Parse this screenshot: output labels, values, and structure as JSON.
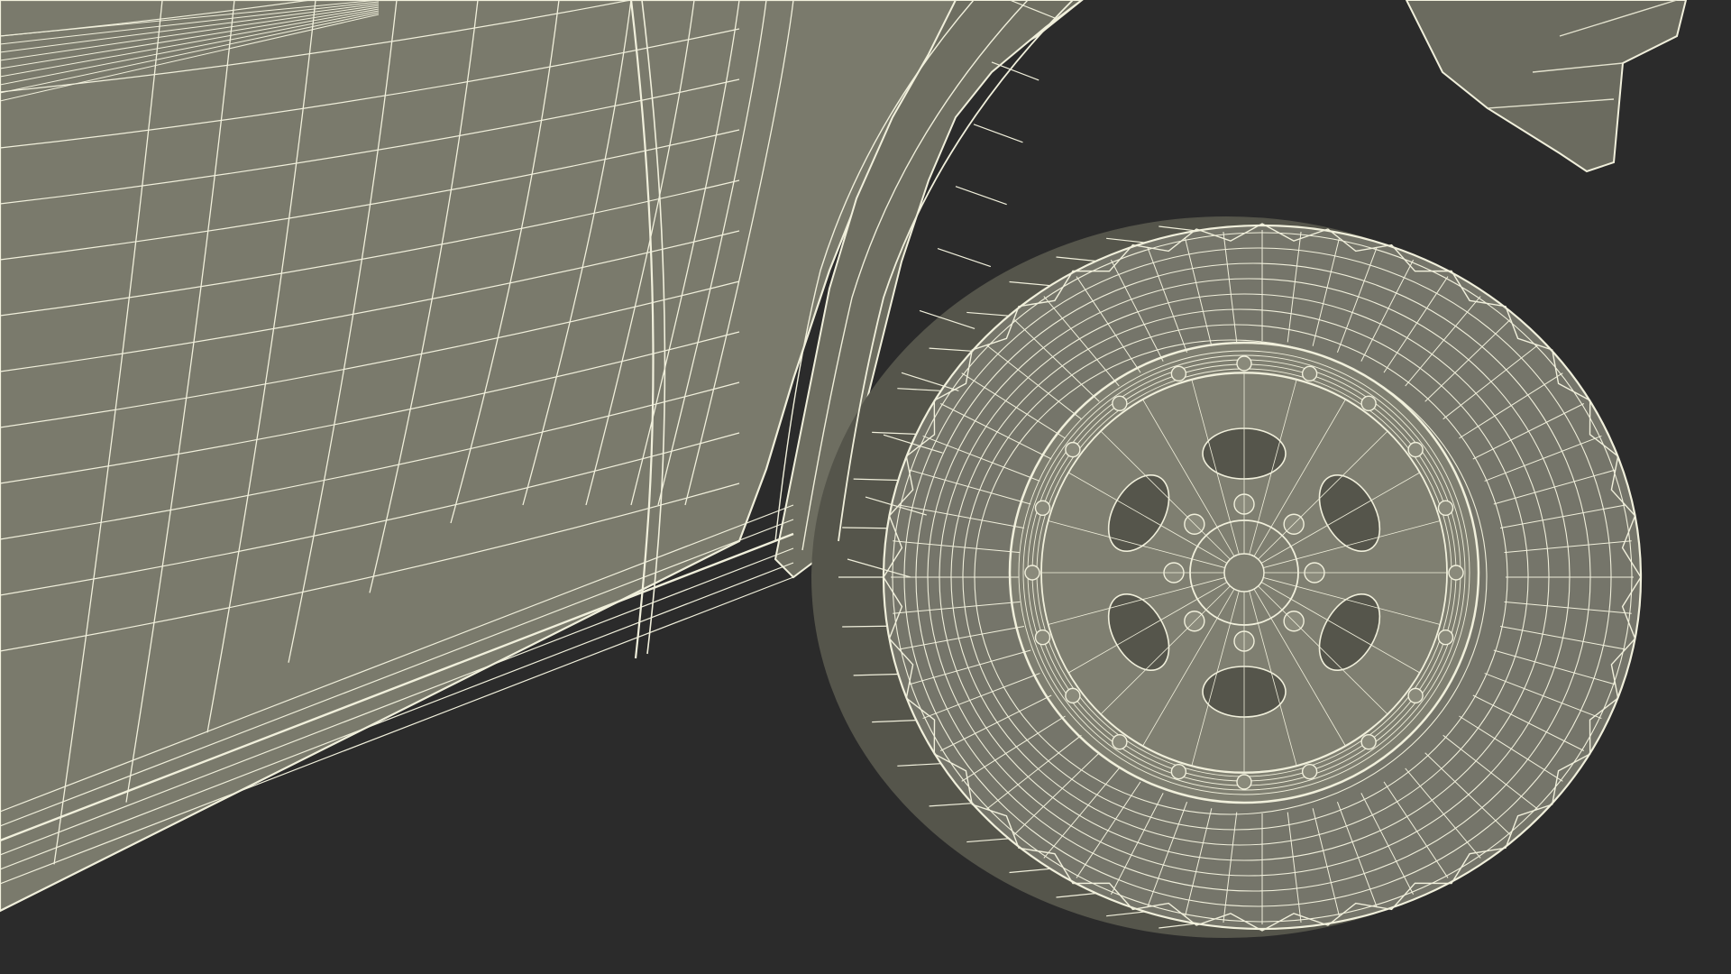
{
  "scene": {
    "subject": "wireframe-render-pickup-front-wheel",
    "colors": {
      "background": "#2b2b2b",
      "body_fill": "#7a7a6c",
      "body_fill_dark": "#6e6e61",
      "tire_fill": "#75756a",
      "tire_shadow": "#55554b",
      "rim_fill": "#7f7f71",
      "wire": "#f1f0dc",
      "wire_dim": "#d9d8c2"
    }
  }
}
